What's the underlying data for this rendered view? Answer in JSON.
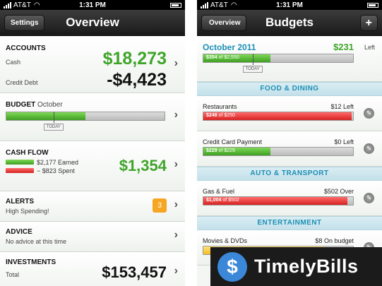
{
  "left": {
    "status": {
      "carrier": "AT&T",
      "time": "1:31 PM"
    },
    "nav": {
      "title": "Overview",
      "back_button": "Settings"
    },
    "accounts": {
      "header": "ACCOUNTS",
      "cash_label": "Cash",
      "cash_value": "$18,273",
      "debt_label": "Credit Debt",
      "debt_value": "-$4,423"
    },
    "budget": {
      "header": "BUDGET",
      "period": "October",
      "progress": 0.5,
      "today_position": 0.3,
      "today_label": "TODAY"
    },
    "cashflow": {
      "header": "CASH FLOW",
      "earned": "$2,177 Earned",
      "spent": "− $823 Spent",
      "total": "$1,354"
    },
    "alerts": {
      "header": "ALERTS",
      "message": "High Spending!",
      "count": "3"
    },
    "advice": {
      "header": "ADVICE",
      "message": "No advice at this time"
    },
    "investments": {
      "header": "INVESTMENTS",
      "total_label": "Total",
      "total_value": "$153,457"
    }
  },
  "right": {
    "status": {
      "carrier": "AT&T",
      "time": "1:31 PM"
    },
    "nav": {
      "title": "Budgets",
      "back_button": "Overview",
      "add_button": "+"
    },
    "summary": {
      "month": "October 2011",
      "left_amount": "$231",
      "left_label": "Left",
      "spent": "$354",
      "of_total": "of $2,550",
      "progress": 0.45,
      "today_position": 0.33,
      "today_label": "TODAY"
    },
    "sections": {
      "food": "FOOD & DINING",
      "auto": "AUTO & TRANSPORT",
      "entertainment": "ENTERTAINMENT"
    },
    "items": [
      {
        "name": "Restaurants",
        "amount": "$12",
        "status": "Left",
        "spent": "$248",
        "of_total": "of $250",
        "progress": 0.99
      },
      {
        "name": "Credit Card Payment",
        "amount": "$0",
        "status": "Left",
        "spent": "$229",
        "of_total": "of $229",
        "progress": 0.45
      },
      {
        "name": "Gas & Fuel",
        "amount": "$502",
        "status": "Over",
        "spent": "$1,004",
        "of_total": "of $502",
        "progress": 0.96
      },
      {
        "name": "Movies & DVDs",
        "amount": "$8",
        "status": "On budget",
        "progress": 0.8
      }
    ]
  },
  "brand": {
    "name": "TimelyBills",
    "logo_symbol": "$"
  },
  "colors": {
    "green_value": "#3fa52a",
    "earned": "#4caf2e",
    "spent": "#e53b3b",
    "accent_blue": "#1c8fb5",
    "badge": "#f6a623"
  }
}
